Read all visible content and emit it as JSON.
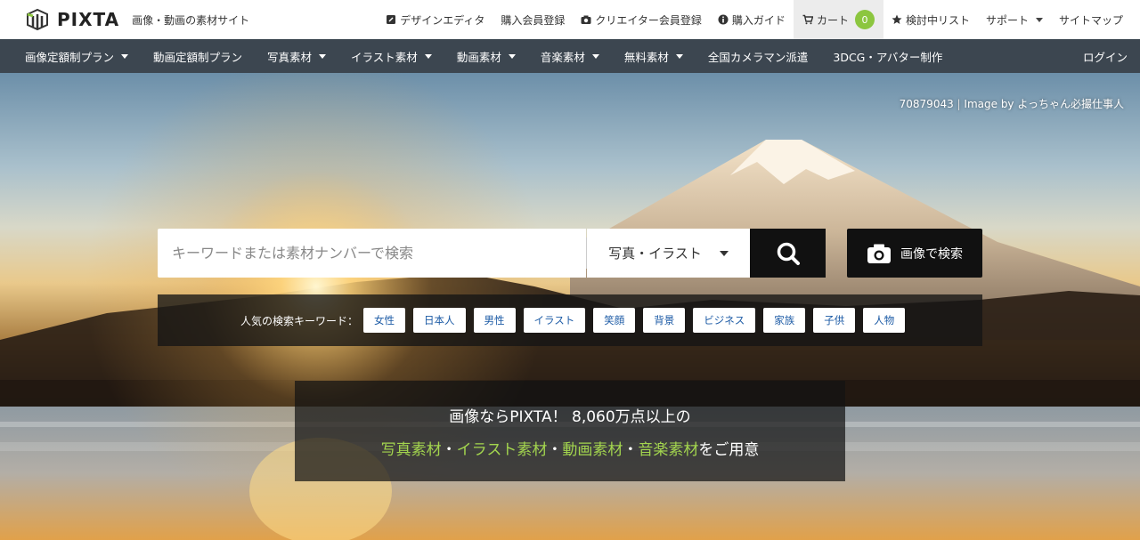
{
  "header": {
    "logo_text": "PIXTA",
    "tagline": "画像・動画の素材サイト",
    "nav": {
      "design_editor": "デザインエディタ",
      "buyer_register": "購入会員登録",
      "creator_register": "クリエイター会員登録",
      "purchase_guide": "購入ガイド",
      "cart": "カート",
      "cart_count": "0",
      "watchlist": "検討中リスト",
      "support": "サポート",
      "sitemap": "サイトマップ"
    }
  },
  "catnav": {
    "items": [
      {
        "label": "画像定額制プラン",
        "dropdown": true
      },
      {
        "label": "動画定額制プラン",
        "dropdown": false
      },
      {
        "label": "写真素材",
        "dropdown": true
      },
      {
        "label": "イラスト素材",
        "dropdown": true
      },
      {
        "label": "動画素材",
        "dropdown": true
      },
      {
        "label": "音楽素材",
        "dropdown": true
      },
      {
        "label": "無料素材",
        "dropdown": true
      },
      {
        "label": "全国カメラマン派遣",
        "dropdown": false
      },
      {
        "label": "3DCG・アバター制作",
        "dropdown": false
      }
    ],
    "login": "ログイン"
  },
  "hero": {
    "credit_id": "70879043",
    "credit_sep": "|",
    "credit_by": "Image by よっちゃん必撮仕事人"
  },
  "search": {
    "placeholder": "キーワードまたは素材ナンバーで検索",
    "type_selected": "写真・イラスト",
    "image_search_label": "画像で検索"
  },
  "popular": {
    "label": "人気の検索キーワード：",
    "keywords": [
      "女性",
      "日本人",
      "男性",
      "イラスト",
      "笑顔",
      "背景",
      "ビジネス",
      "家族",
      "子供",
      "人物"
    ]
  },
  "promo": {
    "line1": "画像ならPIXTA！ 8,060万点以上の",
    "line2_photo": "写真素材",
    "line2_sep1": "・",
    "line2_illust": "イラスト素材",
    "line2_sep2": "・",
    "line2_video": "動画素材",
    "line2_sep3": "・",
    "line2_music": "音楽素材",
    "line2_tail": "をご用意"
  },
  "colors": {
    "catnav_bg": "#3c4650",
    "cart_badge": "#8cc63f",
    "promo_highlight": "#a3d54e",
    "keyword_text": "#1b5aa5"
  }
}
